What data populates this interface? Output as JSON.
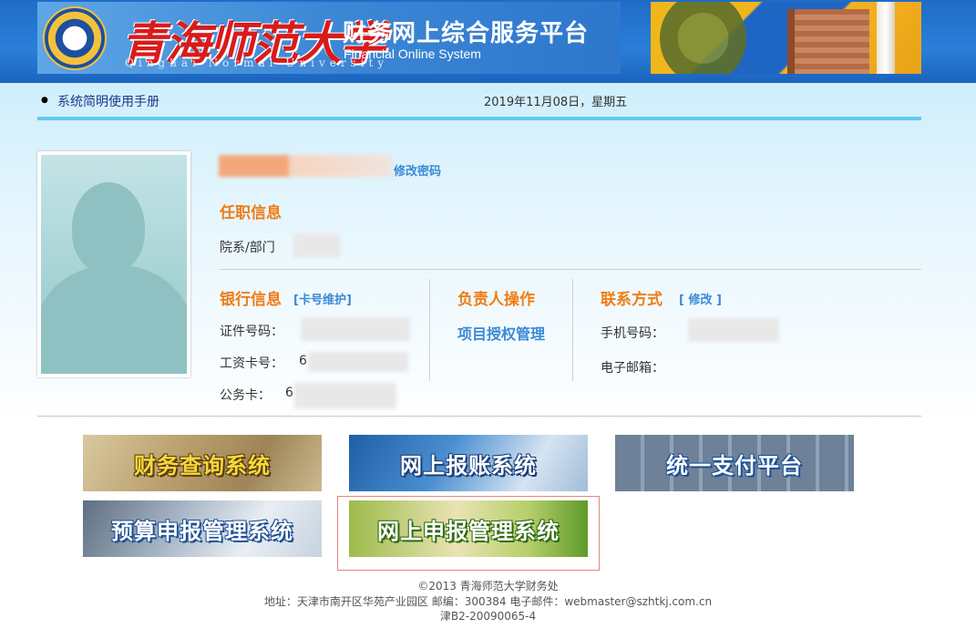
{
  "header": {
    "university_cn": "青海师范大学",
    "university_en": "Qinghai  Normal  University",
    "system_title": "财务网上综合服务平台",
    "system_subtitle": "Financial Online System"
  },
  "nav": {
    "manual_link": "系统简明使用手册",
    "date": "2019年11月08日，星期五"
  },
  "profile": {
    "change_password": "修改密码",
    "job_section_title": "任职信息",
    "department_label": "院系/部门"
  },
  "bank": {
    "title": "银行信息",
    "maintain_link": "[卡号维护]",
    "id_label": "证件号码：",
    "salary_card_label": "工资卡号：",
    "salary_card_prefix": "6",
    "official_card_label": "公务卡：",
    "official_card_prefix": "6"
  },
  "manager": {
    "title": "负责人操作",
    "project_auth_link": "项目授权管理"
  },
  "contact": {
    "title": "联系方式",
    "edit_link": "[ 修改 ]",
    "phone_label": "手机号码：",
    "email_label": "电子邮箱："
  },
  "tiles": [
    {
      "label": "财务查询系统"
    },
    {
      "label": "网上报账系统"
    },
    {
      "label": "统一支付平台"
    },
    {
      "label": "预算申报管理系统"
    },
    {
      "label": "网上申报管理系统"
    }
  ],
  "footer": {
    "copyright": "©2013 青海师范大学财务处",
    "address": "地址：天津市南开区华苑产业园区 邮编：300384 电子邮件：webmaster@szhtkj.com.cn",
    "license": "津B2-20090065-4"
  },
  "colors": {
    "accent_orange": "#f07c14",
    "link_blue": "#3a8ad6",
    "header_blue": "#2a7fd8",
    "nav_border": "#5fcbf1"
  }
}
